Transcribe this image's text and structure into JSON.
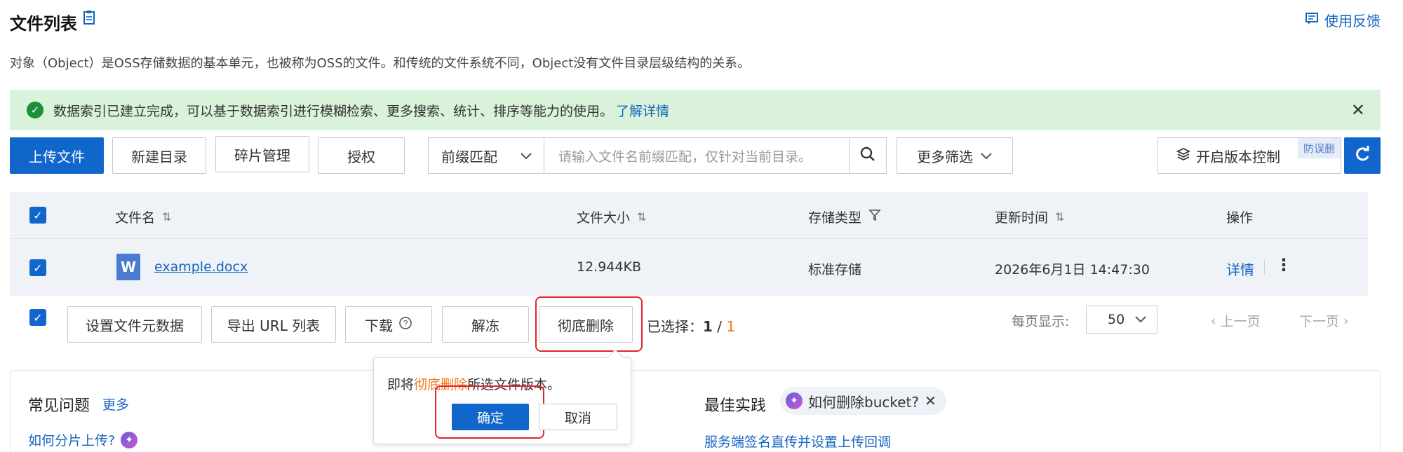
{
  "header": {
    "title": "文件列表",
    "feedback": "使用反馈",
    "description": "对象（Object）是OSS存储数据的基本单元，也被称为OSS的文件。和传统的文件系统不同，Object没有文件目录层级结构的关系。"
  },
  "banner": {
    "text": "数据索引已建立完成，可以基于数据索引进行模糊检索、更多搜索、统计、排序等能力的使用。",
    "link": "了解详情"
  },
  "toolbar": {
    "upload": "上传文件",
    "new_dir": "新建目录",
    "fragments": "碎片管理",
    "authorize": "授权",
    "match_mode": "前缀匹配",
    "search_placeholder": "请输入文件名前缀匹配，仅针对当前目录。",
    "more_filter": "更多筛选",
    "version_control": "开启版本控制",
    "version_tag": "防误删"
  },
  "table": {
    "columns": [
      "文件名",
      "文件大小",
      "存储类型",
      "更新时间",
      "操作"
    ],
    "rows": [
      {
        "name": "example.docx",
        "size": "12.944KB",
        "storage": "标准存储",
        "updated": "2026年6月1日 14:47:30",
        "action": "详情"
      }
    ]
  },
  "bulk": {
    "set_meta": "设置文件元数据",
    "export_url": "导出 URL 列表",
    "download": "下载",
    "unfreeze": "解冻",
    "delete": "彻底删除",
    "selected_label": "已选择：",
    "selected_count": "1",
    "selected_sep": " / ",
    "selected_total": "1"
  },
  "pagination": {
    "page_size_label": "每页显示:",
    "page_size": "50",
    "prev": "上一页",
    "next": "下一页"
  },
  "popover": {
    "text_before": "即将",
    "text_warn": "彻底删除",
    "text_after": "所选文件版本。",
    "confirm": "确定",
    "cancel": "取消"
  },
  "faq": {
    "title": "常见问题",
    "more": "更多",
    "item": "如何分片上传?"
  },
  "best_practice": {
    "title": "最佳实践",
    "chip": "如何删除bucket?",
    "item": "服务端签名直传并设置上传回调"
  }
}
